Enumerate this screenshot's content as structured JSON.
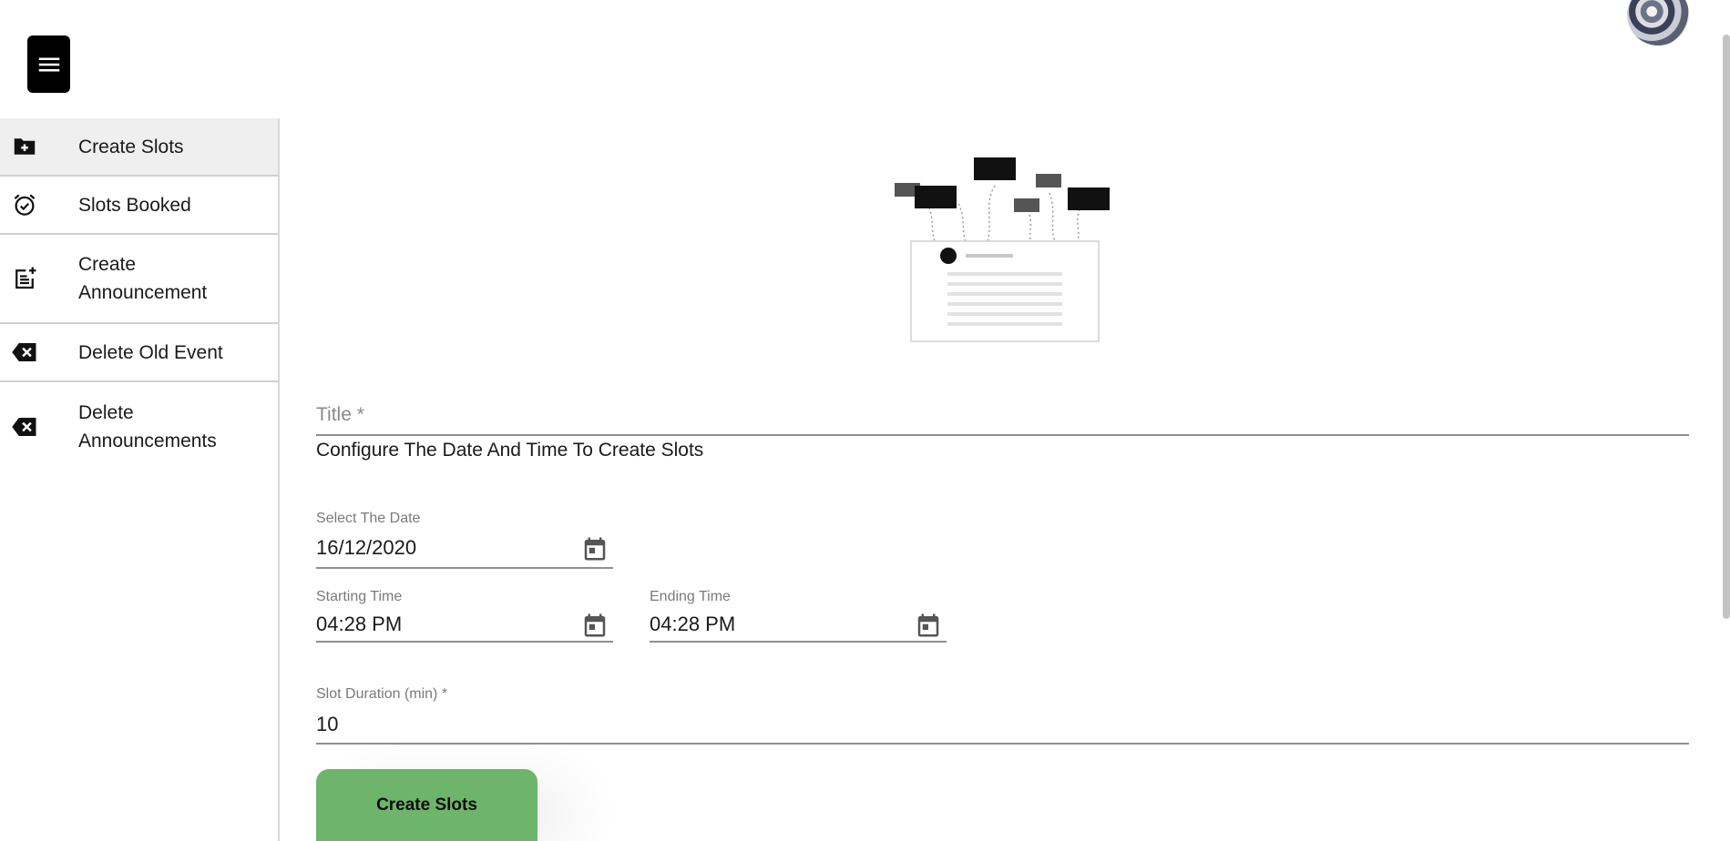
{
  "header": {
    "menu_icon": "hamburger-menu-icon",
    "avatar_icon": "user-avatar"
  },
  "sidebar": {
    "items": [
      {
        "label": "Create Slots",
        "icon": "folder-plus-icon",
        "active": true
      },
      {
        "label": "Slots Booked",
        "icon": "alarm-check-icon",
        "active": false
      },
      {
        "label": "Create\nAnnouncement",
        "icon": "post-add-icon",
        "active": false
      },
      {
        "label": "Delete Old Event",
        "icon": "backspace-x-icon",
        "active": false
      },
      {
        "label": "Delete\nAnnouncements",
        "icon": "backspace-x-icon",
        "active": false
      }
    ]
  },
  "form": {
    "title_label": "Title *",
    "title_value": "Configure The Date And Time To Create Slots",
    "date_label": "Select The Date",
    "date_value": "16/12/2020",
    "start_label": "Starting Time",
    "start_value": "04:28 PM",
    "end_label": "Ending Time",
    "end_value": "04:28 PM",
    "duration_label": "Slot Duration (min) *",
    "duration_value": "10",
    "submit_label": "Create Slots"
  },
  "colors": {
    "accent_green": "#6db56b",
    "active_item_bg": "#efefef",
    "menu_button_bg": "#000000"
  }
}
